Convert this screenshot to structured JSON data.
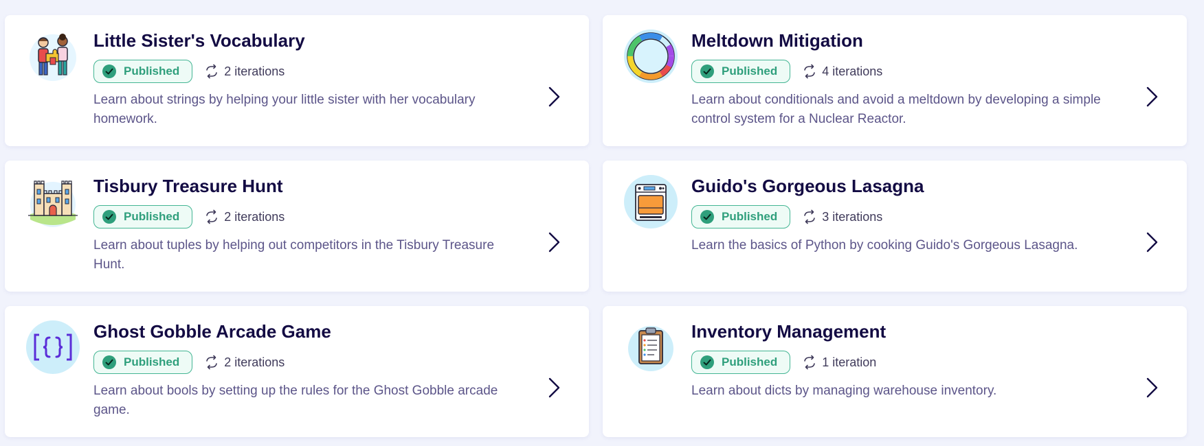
{
  "colors": {
    "background": "#f1f3fc",
    "card": "#ffffff",
    "title": "#130b43",
    "published_green": "#2f9f7c",
    "blurb": "#5c5589"
  },
  "cards": [
    {
      "title": "Little Sister's Vocabulary",
      "status": "Published",
      "iterations": "2 iterations",
      "description": "Learn about strings by helping your little sister with her vocabulary homework.",
      "icon": "kids-puzzle-icon"
    },
    {
      "title": "Meltdown Mitigation",
      "status": "Published",
      "iterations": "4 iterations",
      "description": "Learn about conditionals and avoid a meltdown by developing a simple control system for a Nuclear Reactor.",
      "icon": "color-ring-icon"
    },
    {
      "title": "Tisbury Treasure Hunt",
      "status": "Published",
      "iterations": "2 iterations",
      "description": "Learn about tuples by helping out competitors in the Tisbury Treasure Hunt.",
      "icon": "castle-icon"
    },
    {
      "title": "Guido's Gorgeous Lasagna",
      "status": "Published",
      "iterations": "3 iterations",
      "description": "Learn the basics of Python by cooking Guido's Gorgeous Lasagna.",
      "icon": "oven-icon"
    },
    {
      "title": "Ghost Gobble Arcade Game",
      "status": "Published",
      "iterations": "2 iterations",
      "description": "Learn about bools by setting up the rules for the Ghost Gobble arcade game.",
      "icon": "curly-braces-icon"
    },
    {
      "title": "Inventory Management",
      "status": "Published",
      "iterations": "1 iteration",
      "description": "Learn about dicts by managing warehouse inventory.",
      "icon": "clipboard-icon"
    }
  ]
}
